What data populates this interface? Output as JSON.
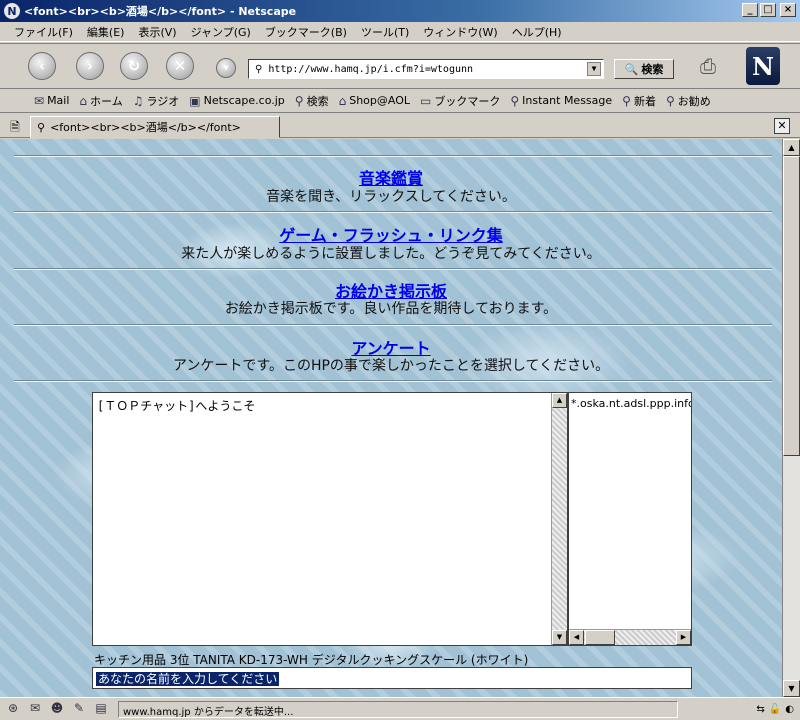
{
  "window": {
    "title": "<font><br><b>酒場</b></font> - Netscape",
    "min": "_",
    "max": "□",
    "close": "×"
  },
  "menu": [
    "ファイル(F)",
    "編集(E)",
    "表示(V)",
    "ジャンプ(G)",
    "ブックマーク(B)",
    "ツール(T)",
    "ウィンドウ(W)",
    "ヘルプ(H)"
  ],
  "nav": {
    "url": "http://www.hamq.jp/i.cfm?i=wtogunn",
    "search_label": "検索"
  },
  "personal_bar": [
    "Mail",
    "ホーム",
    "ラジオ",
    "Netscape.co.jp",
    "検索",
    "Shop@AOL",
    "ブックマーク",
    "Instant Message",
    "新着",
    "お勧め"
  ],
  "tab": {
    "label": "<font><br><b>酒場</b></font>"
  },
  "sections": [
    {
      "link": "音楽鑑賞",
      "desc": "音楽を聞き、リラックスしてください。"
    },
    {
      "link": "ゲーム・フラッシュ・リンク集",
      "desc": "来た人が楽しめるように設置しました。どうぞ見てみてください。"
    },
    {
      "link": "お絵かき掲示板",
      "desc": "お絵かき掲示板です。良い作品を期待しております。"
    },
    {
      "link": "アンケート",
      "desc": "アンケートです。このHPの事で楽しかったことを選択してください。"
    }
  ],
  "chat": {
    "welcome": "[ＴＯＰチャット]へようこそ",
    "user": "*.oska.nt.adsl.ppp.infoweb",
    "ad": "キッチン用品 3位 TANITA KD-173-WH デジタルクッキングスケール (ホワイト)",
    "name_prompt": "あなたの名前を入力してください"
  },
  "status": {
    "text": "www.hamq.jp からデータを転送中..."
  }
}
